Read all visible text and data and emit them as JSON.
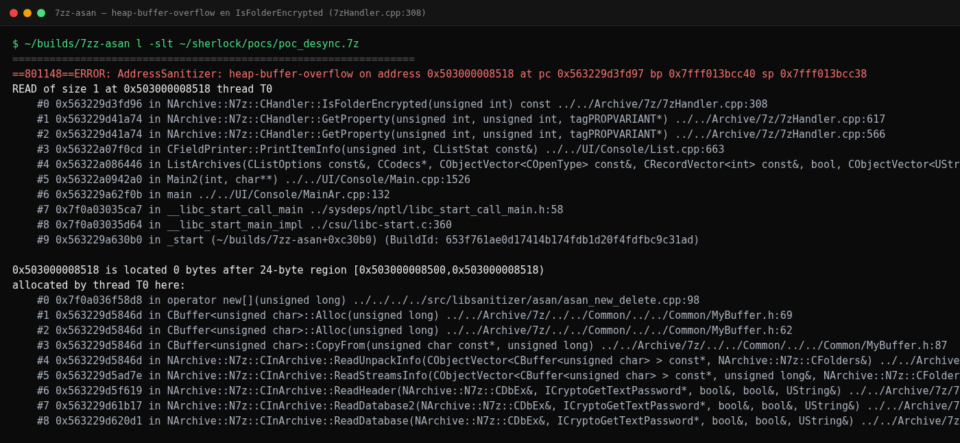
{
  "window": {
    "title": "7zz-asan — heap-buffer-overflow en IsFolderEncrypted (7zHandler.cpp:308)"
  },
  "lines": [
    {
      "kind": "command",
      "text": "$ ~/builds/7zz-asan l -slt ~/sherlock/pocs/poc_desync.7z"
    },
    {
      "kind": "separator",
      "text": "================================================================="
    },
    {
      "kind": "error",
      "text": "==801148==ERROR: AddressSanitizer: heap-buffer-overflow on address 0x503000008518 at pc 0x563229d3fd97 bp 0x7fff013bcc40 sp 0x7fff013bcc38"
    },
    {
      "kind": "plain",
      "text": "READ of size 1 at 0x503000008518 thread T0"
    },
    {
      "kind": "frame",
      "text": "#0 0x563229d3fd96 in NArchive::N7z::CHandler::IsFolderEncrypted(unsigned int) const ../../Archive/7z/7zHandler.cpp:308"
    },
    {
      "kind": "frame",
      "text": "#1 0x563229d41a74 in NArchive::N7z::CHandler::GetProperty(unsigned int, unsigned int, tagPROPVARIANT*) ../../Archive/7z/7zHandler.cpp:617"
    },
    {
      "kind": "frame",
      "text": "#2 0x563229d41a74 in NArchive::N7z::CHandler::GetProperty(unsigned int, unsigned int, tagPROPVARIANT*) ../../Archive/7z/7zHandler.cpp:566"
    },
    {
      "kind": "frame",
      "text": "#3 0x56322a07f0cd in CFieldPrinter::PrintItemInfo(unsigned int, CListStat const&) ../../UI/Console/List.cpp:663"
    },
    {
      "kind": "frame",
      "text": "#4 0x56322a086446 in ListArchives(CListOptions const&, CCodecs*, CObjectVector<COpenType> const&, CRecordVector<int> const&, bool, CObjectVector<UStr"
    },
    {
      "kind": "frame",
      "text": "#5 0x56322a0942a0 in Main2(int, char**) ../../UI/Console/Main.cpp:1526"
    },
    {
      "kind": "frame",
      "text": "#6 0x563229a62f0b in main ../../UI/Console/MainAr.cpp:132"
    },
    {
      "kind": "frame",
      "text": "#7 0x7f0a03035ca7 in __libc_start_call_main ../sysdeps/nptl/libc_start_call_main.h:58"
    },
    {
      "kind": "frame",
      "text": "#8 0x7f0a03035d64 in __libc_start_main_impl ../csu/libc-start.c:360"
    },
    {
      "kind": "frame",
      "text": "#9 0x563229a630b0 in _start (~/builds/7zz-asan+0xc30b0) (BuildId: 653f761ae0d17414b174fdb1d20f4fdfbc9c31ad)"
    },
    {
      "kind": "blank"
    },
    {
      "kind": "plain",
      "text": "0x503000008518 is located 0 bytes after 24-byte region [0x503000008500,0x503000008518)"
    },
    {
      "kind": "plain",
      "text": "allocated by thread T0 here:"
    },
    {
      "kind": "frame",
      "text": "#0 0x7f0a036f58d8 in operator new[](unsigned long) ../../../../src/libsanitizer/asan/asan_new_delete.cpp:98"
    },
    {
      "kind": "frame",
      "text": "#1 0x563229d5846d in CBuffer<unsigned char>::Alloc(unsigned long) ../../Archive/7z/../../Common/../../Common/MyBuffer.h:69"
    },
    {
      "kind": "frame",
      "text": "#2 0x563229d5846d in CBuffer<unsigned char>::Alloc(unsigned long) ../../Archive/7z/../../Common/../../Common/MyBuffer.h:62"
    },
    {
      "kind": "frame",
      "text": "#3 0x563229d5846d in CBuffer<unsigned char>::CopyFrom(unsigned char const*, unsigned long) ../../Archive/7z/../../Common/../../Common/MyBuffer.h:87"
    },
    {
      "kind": "frame",
      "text": "#4 0x563229d5846d in NArchive::N7z::CInArchive::ReadUnpackInfo(CObjectVector<CBuffer<unsigned char> > const*, NArchive::N7z::CFolders&) ../../Archive"
    },
    {
      "kind": "frame",
      "text": "#5 0x563229d5ad7e in NArchive::N7z::CInArchive::ReadStreamsInfo(CObjectVector<CBuffer<unsigned char> > const*, unsigned long&, NArchive::N7z::CFolder"
    },
    {
      "kind": "frame",
      "text": "#6 0x563229d5f619 in NArchive::N7z::CInArchive::ReadHeader(NArchive::N7z::CDbEx&, ICryptoGetTextPassword*, bool&, bool&, UString&) ../../Archive/7z/7"
    },
    {
      "kind": "frame",
      "text": "#7 0x563229d61b17 in NArchive::N7z::CInArchive::ReadDatabase2(NArchive::N7z::CDbEx&, ICryptoGetTextPassword*, bool&, bool&, UString&) ../../Archive/7"
    },
    {
      "kind": "frame",
      "text": "#8 0x563229d620d1 in NArchive::N7z::CInArchive::ReadDatabase(NArchive::N7z::CDbEx&, ICryptoGetTextPassword*, bool&, bool&, UString&) ../../Archive/7z"
    }
  ]
}
